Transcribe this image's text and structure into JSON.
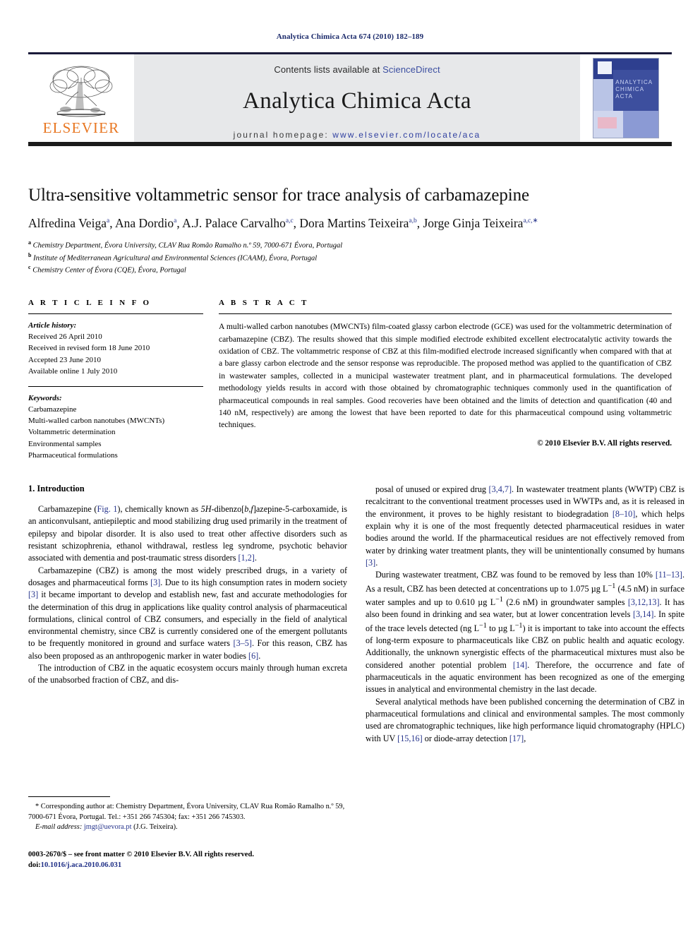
{
  "running_head": "Analytica Chimica Acta 674 (2010) 182–189",
  "masthead": {
    "publisher_name": "ELSEVIER",
    "contents_prefix": "Contents lists available at ",
    "contents_link": "ScienceDirect",
    "journal_title": "Analytica Chimica Acta",
    "homepage_prefix": "journal homepage: ",
    "homepage_url": "www.elsevier.com/locate/aca",
    "cover_title_line1": "ANALYTICA",
    "cover_title_line2": "CHIMICA ACTA",
    "link_color": "#2f3fa0",
    "brand_orange": "#E87722"
  },
  "article": {
    "title": "Ultra-sensitive voltammetric sensor for trace analysis of carbamazepine",
    "authors_html": "Alfredina Veiga<sup>a</sup>, Ana Dordio<sup>a</sup>, A.J. Palace Carvalho<sup>a,c</sup>, Dora Martins Teixeira<sup>a,b</sup>, Jorge Ginja Teixeira<sup>a,c,∗</sup>",
    "affiliations": [
      "Chemistry Department, Évora University, CLAV Rua Romão Ramalho n.º 59, 7000-671 Évora, Portugal",
      "Institute of Mediterranean Agricultural and Environmental Sciences (ICAAM), Évora, Portugal",
      "Chemistry Center of Évora (CQE), Évora, Portugal"
    ],
    "affiliation_marks": [
      "a",
      "b",
      "c"
    ]
  },
  "article_info": {
    "heading": "A R T I C L E   I N F O",
    "history_label": "Article history:",
    "history": [
      "Received 26 April 2010",
      "Received in revised form 18 June 2010",
      "Accepted 23 June 2010",
      "Available online 1 July 2010"
    ],
    "keywords_label": "Keywords:",
    "keywords": [
      "Carbamazepine",
      "Multi-walled carbon nanotubes (MWCNTs)",
      "Voltammetric determination",
      "Environmental samples",
      "Pharmaceutical formulations"
    ]
  },
  "abstract": {
    "heading": "A B S T R A C T",
    "text": "A multi-walled carbon nanotubes (MWCNTs) film-coated glassy carbon electrode (GCE) was used for the voltammetric determination of carbamazepine (CBZ). The results showed that this simple modified electrode exhibited excellent electrocatalytic activity towards the oxidation of CBZ. The voltammetric response of CBZ at this film-modified electrode increased significantly when compared with that at a bare glassy carbon electrode and the sensor response was reproducible. The proposed method was applied to the quantification of CBZ in wastewater samples, collected in a municipal wastewater treatment plant, and in pharmaceutical formulations. The developed methodology yields results in accord with those obtained by chromatographic techniques commonly used in the quantification of pharmaceutical compounds in real samples. Good recoveries have been obtained and the limits of detection and quantification (40 and 140 nM, respectively) are among the lowest that have been reported to date for this pharmaceutical compound using voltammetric techniques.",
    "copyright": "© 2010 Elsevier B.V. All rights reserved."
  },
  "introduction": {
    "heading": "1.  Introduction",
    "left_paragraphs": [
      "Carbamazepine (Fig. 1), chemically known as 5H-dibenzo[b,f]azepine-5-carboxamide, is an anticonvulsant, antiepileptic and mood stabilizing drug used primarily in the treatment of epilepsy and bipolar disorder. It is also used to treat other affective disorders such as resistant schizophrenia, ethanol withdrawal, restless leg syndrome, psychotic behavior associated with dementia and post-traumatic stress disorders [1,2].",
      "Carbamazepine (CBZ) is among the most widely prescribed drugs, in a variety of dosages and pharmaceutical forms [3]. Due to its high consumption rates in modern society [3] it became important to develop and establish new, fast and accurate methodologies for the determination of this drug in applications like quality control analysis of pharmaceutical formulations, clinical control of CBZ consumers, and especially in the field of analytical environmental chemistry, since CBZ is currently considered one of the emergent pollutants to be frequently monitored in ground and surface waters [3–5]. For this reason, CBZ has also been proposed as an anthropogenic marker in water bodies [6].",
      "The introduction of CBZ in the aquatic ecosystem occurs mainly through human excreta of the unabsorbed fraction of CBZ, and dis-"
    ],
    "right_paragraphs": [
      "posal of unused or expired drug [3,4,7]. In wastewater treatment plants (WWTP) CBZ is recalcitrant to the conventional treatment processes used in WWTPs and, as it is released in the environment, it proves to be highly resistant to biodegradation [8–10], which helps explain why it is one of the most frequently detected pharmaceutical residues in water bodies around the world. If the pharmaceutical residues are not effectively removed from water by drinking water treatment plants, they will be unintentionally consumed by humans [3].",
      "During wastewater treatment, CBZ was found to be removed by less than 10% [11–13]. As a result, CBZ has been detected at concentrations up to 1.075 µg L−1 (4.5 nM) in surface water samples and up to 0.610 µg L−1 (2.6 nM) in groundwater samples [3,12,13]. It has also been found in drinking and sea water, but at lower concentration levels [3,14]. In spite of the trace levels detected (ng L−1 to µg L−1) it is important to take into account the effects of long-term exposure to pharmaceuticals like CBZ on public health and aquatic ecology. Additionally, the unknown synergistic effects of the pharmaceutical mixtures must also be considered another potential problem [14]. Therefore, the occurrence and fate of pharmaceuticals in the aquatic environment has been recognized as one of the emerging issues in analytical and environmental chemistry in the last decade.",
      "Several analytical methods have been published concerning the determination of CBZ in pharmaceutical formulations and clinical and environmental samples. The most commonly used are chromatographic techniques, like high performance liquid chromatography (HPLC) with UV [15,16] or diode-array detection [17],"
    ]
  },
  "footnotes": {
    "corresponding": "* Corresponding author at: Chemistry Department, Évora University, CLAV Rua Romão Ramalho n.º 59, 7000-671 Évora, Portugal. Tel.: +351 266 745304; fax: +351 266 745303.",
    "email_label": "E-mail address:",
    "email": "jmgt@uevora.pt",
    "email_suffix": "(J.G. Teixeira).",
    "issn_line": "0003-2670/$ – see front matter © 2010 Elsevier B.V. All rights reserved.",
    "doi_label": "doi:",
    "doi": "10.1016/j.aca.2010.06.031"
  }
}
